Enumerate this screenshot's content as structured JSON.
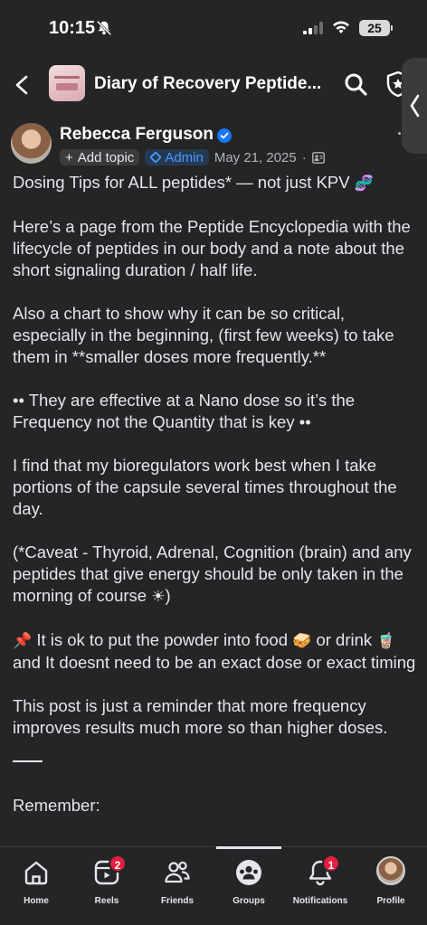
{
  "status": {
    "time": "10:15",
    "battery": "25"
  },
  "header": {
    "title": "Diary of Recovery Peptide..."
  },
  "post": {
    "author": "Rebecca Ferguson",
    "add_topic": "Add topic",
    "admin": "Admin",
    "date": "May 21, 2025",
    "dot": "·",
    "paragraphs": [
      "Dosing Tips for ALL peptides* — not just KPV",
      "Here’s a page from the Peptide Encyclopedia with the lifecycle of peptides in our body and a note about the short signaling duration / half life.",
      "Also a chart to show why it can be so critical, especially in the beginning, (first few weeks) to take them in **smaller doses more frequently.**",
      "•• They are effective at a Nano dose so it’s the Frequency not the Quantity that is key ••",
      "I find that my bioregulators work best when I take portions of the capsule several times throughout the day.",
      "(*Caveat - Thyroid, Adrenal, Cognition (brain) and any peptides that give energy should be only taken in the morning of course",
      "It is ok to put the powder into food",
      "or drink",
      "and It doesnt need to be an exact dose or exact timing",
      "This post is just a reminder that more frequency improves results much more so than higher doses.",
      "Remember:"
    ],
    "emoji_dna": "🧬",
    "emoji_sun": "☀",
    "close_paren": ")",
    "emoji_pin": "📌",
    "emoji_sandwich": "🥪",
    "emoji_drink": "🧋"
  },
  "nav": {
    "items": [
      {
        "label": "Home",
        "icon": "home-icon"
      },
      {
        "label": "Reels",
        "icon": "reels-icon",
        "badge": "2"
      },
      {
        "label": "Friends",
        "icon": "friends-icon"
      },
      {
        "label": "Groups",
        "icon": "groups-icon"
      },
      {
        "label": "Notifications",
        "icon": "bell-icon",
        "badge": "1"
      },
      {
        "label": "Profile",
        "icon": "profile-avatar"
      }
    ]
  },
  "colors": {
    "background": "#242526",
    "accent": "#4599ff",
    "badge": "#e41e3f"
  }
}
